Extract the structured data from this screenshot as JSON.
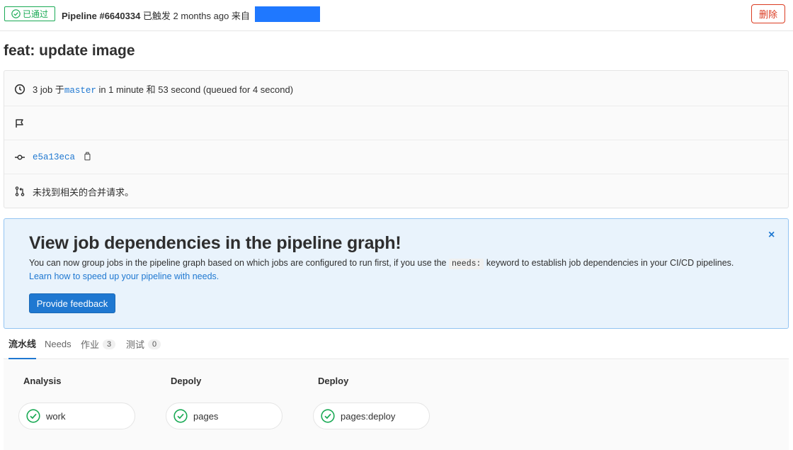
{
  "header": {
    "status": "已通过",
    "pipeline_label": "Pipeline #6640334",
    "triggered_text": " 已触发 2 months ago 来自",
    "delete_label": "删除"
  },
  "title": "feat: update image",
  "info": {
    "jobs_prefix": "3 job 于",
    "branch": "master",
    "duration_text": " in 1 minute 和 53 second (queued for 4 second)",
    "commit_sha": "e5a13eca",
    "merge_request_text": "未找到相关的合并请求。"
  },
  "banner": {
    "title": "View job dependencies in the pipeline graph!",
    "text_before": "You can now group jobs in the pipeline graph based on which jobs are configured to run first, if you use the ",
    "keyword": "needs:",
    "text_after": " keyword to establish job dependencies in your CI/CD pipelines.",
    "link": "Learn how to speed up your pipeline with needs.",
    "button": "Provide feedback",
    "close": "×"
  },
  "tabs": [
    {
      "label": "流水线"
    },
    {
      "label": "Needs"
    },
    {
      "label": "作业",
      "count": "3"
    },
    {
      "label": "测试",
      "count": "0"
    }
  ],
  "stages": [
    {
      "title": "Analysis",
      "job": "work"
    },
    {
      "title": "Depoly",
      "job": "pages"
    },
    {
      "title": "Deploy",
      "job": "pages:deploy"
    }
  ],
  "colors": {
    "success": "#1aaa55",
    "danger": "#db3b21",
    "link": "#1f78d1",
    "banner_bg": "#e9f3fc"
  }
}
